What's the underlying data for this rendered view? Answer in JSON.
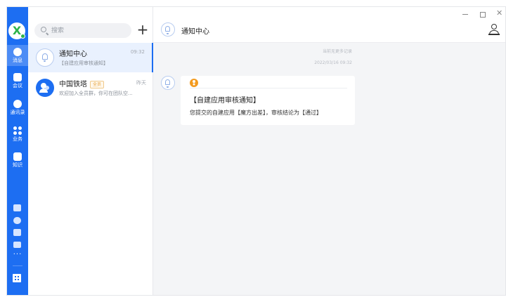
{
  "nav": {
    "items": [
      {
        "label": "消息"
      },
      {
        "label": "会议"
      },
      {
        "label": "通讯录"
      },
      {
        "label": "业务"
      },
      {
        "label": "知识"
      }
    ],
    "more": "···"
  },
  "list": {
    "search_placeholder": "搜索",
    "add_label": "+",
    "conversations": [
      {
        "name": "通知中心",
        "time": "09:32",
        "preview": "【自建应用审核通知】"
      },
      {
        "name": "中国铁塔",
        "tag": "全员",
        "time": "昨天",
        "preview": "欢迎加入全员群，你可在团队空..."
      }
    ]
  },
  "chat": {
    "title": "通知中心",
    "notes": [
      "当前无更多记录",
      "2022/03/16 09:32"
    ],
    "message": {
      "title": "【自建应用审核通知】",
      "body": "您提交的自建应用【魔方出差】，审核结论为【通过】"
    }
  },
  "window": {
    "minimize": "–",
    "close": "✕"
  },
  "colors": {
    "nav_bg": "#1d6ef2",
    "selected_bg": "#e9f1fe",
    "badge": "#f39b1f",
    "chat_bg": "#f4f5f7"
  }
}
